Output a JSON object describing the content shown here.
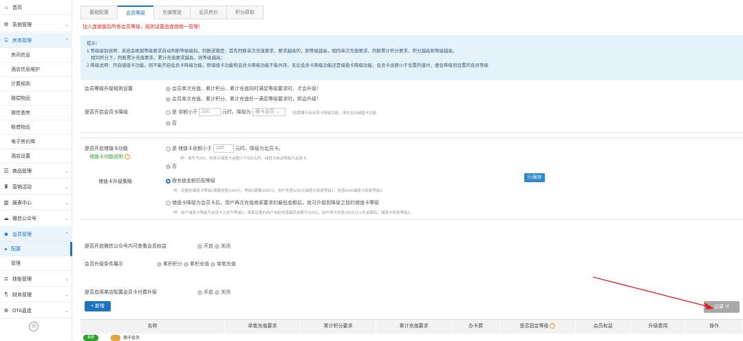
{
  "sidebar": {
    "items": [
      {
        "icon": "home-icon",
        "label": "首页"
      },
      {
        "icon": "gear-icon",
        "label": "系统管理"
      },
      {
        "icon": "building-icon",
        "label": "房务管理"
      },
      {
        "icon": "database-icon",
        "label": "商品管理"
      },
      {
        "icon": "megaphone-icon",
        "label": "营销活动"
      },
      {
        "icon": "chart-icon",
        "label": "报表中心"
      },
      {
        "icon": "cloud-icon",
        "label": "微信公众号"
      },
      {
        "icon": "members-icon",
        "label": "会员管理"
      },
      {
        "icon": "list-icon",
        "label": "挂账管理"
      },
      {
        "icon": "finance-icon",
        "label": "财务管理"
      },
      {
        "icon": "link-icon",
        "label": "OTA直连"
      }
    ],
    "room_sub": [
      "房间信息",
      "酒店信息维护",
      "计费规则",
      "赔偿物品",
      "微信查房",
      "租借物品",
      "电子房价牌",
      "酒店设置"
    ],
    "member_sub": [
      "配置",
      "管理"
    ],
    "collapse_glyph": "◎"
  },
  "tabs": [
    "基础配置",
    "会员等级",
    "充值赠送",
    "会员房价",
    "积分获取"
  ],
  "warning": "加入连锁版后所有会员等级，规则设置由连锁统一管理！",
  "tips": {
    "title": "提示：",
    "lines": [
      "1.等级级别说明：系统会根据等级要求自动判断等级级别。判断逻辑是：首先判断单次充值要求，要求越高的，则等级越高，相同单次充值要求，判断累计积分要求，积分越高则等级越高。",
      "相同积分下，判断累计充值要求，累计充值要求越高，则等级越高；",
      "2.降级说明：开启储值卡功能，则不能开启会员卡降级功能，即储值卡功能和会员卡降级功能不能共存。无论会员卡降级功能还是储值卡降级功能，会员卡余额小于设置的值时，便会降级到设置的会员等级"
    ]
  },
  "upgrade_rule": {
    "label": "会员等级升级规则设置",
    "options": [
      "会员单次充值、累计积分、累计充值同时满足等级要求时，才会升级！",
      "会员单次充值、累计积分、累计充值任一满足等级要求时，即会升级！"
    ]
  },
  "downgrade": {
    "label": "是否开启会员卡降级",
    "yes_prefix": "是  余额小于",
    "amount": "200",
    "mid": "元时，降级为",
    "select": "银卡会员",
    "note": "*若需要开启会员卡降级功能，请先关闭储值卡功能",
    "no": "否"
  },
  "stored_card": {
    "label": "是否开启储值卡功能",
    "help_link": "储值卡功能说明",
    "yes_prefix": "是  储值卡余额小于",
    "amount": "100",
    "mid": "元时，降级为会员卡。",
    "example": "例：填写为500，则表示储值卡金额小于500元时，储值卡自动降级为会员卡。",
    "no": "否",
    "strategy_label": "储值卡升级策略",
    "strategy1": "按充值金额匹配等级",
    "strategy1_ex": "例：设置的储值卡等级1需要充值1000元，等级2需要2000元，用户充值1000元储值卡就是等级1，充值2000储值卡就是等级2。",
    "strategy2": "储值卡降级为会员卡后，用户再次充值商家要求的最低金额后，就可升级到降级之前的储值卡等级",
    "strategy2_ex": "例：用户储值卡降级为会员卡之前为等级2，商家设置的用户自助充值最低金额为100元，用户再次充值100元以上的金额后，储值卡恢复等级2。",
    "save": "保存"
  },
  "wechat_view": {
    "label": "是否开启微信公众号内可查看会员权益",
    "on": "开启",
    "off": "关闭"
  },
  "display_cond": {
    "label": "会员升级条件展示",
    "opts": [
      "累积积分",
      "累积充值",
      "单笔充值"
    ]
  },
  "paid_upgrade": {
    "label": "是否启用单店配置会员卡付费升级",
    "on": "开启",
    "off": "关闭"
  },
  "actions": {
    "add": "+ 新增",
    "record": "记录"
  },
  "table": {
    "headers": [
      "名称",
      "单笔充值要求",
      "累计积分要求",
      "累计充值要求",
      "办卡费",
      "是否固定等级",
      "会员权益",
      "升级费用",
      "操作"
    ],
    "peek_name": "银卡会员",
    "peek_badge": "系统"
  }
}
